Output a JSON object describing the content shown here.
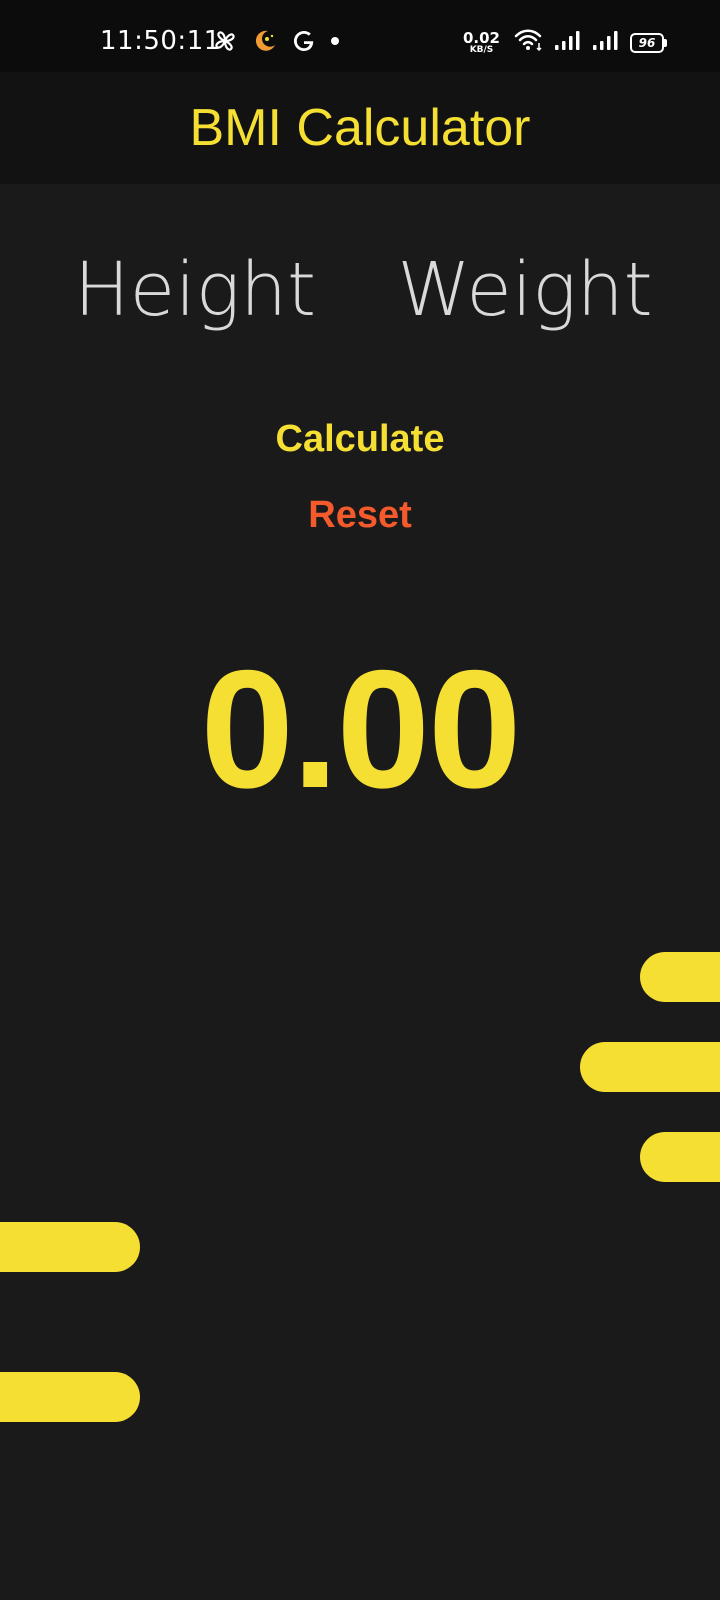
{
  "status_bar": {
    "time": "11:50:11",
    "net_speed_value": "0.02",
    "net_speed_unit": "KB/S",
    "battery_level": "96",
    "left_icons": [
      "pinwheel-icon",
      "moon-star-icon",
      "google-icon",
      "dot-icon"
    ],
    "right_icons": [
      "wifi-icon",
      "signal-icon",
      "signal-icon"
    ]
  },
  "app_bar": {
    "title": "BMI Calculator"
  },
  "inputs": {
    "height_placeholder": "Height",
    "weight_placeholder": "Weight"
  },
  "actions": {
    "calculate_label": "Calculate",
    "reset_label": "Reset"
  },
  "result": {
    "bmi_value": "0.00"
  },
  "colors": {
    "accent": "#f5df33",
    "reset": "#f55a2c",
    "background": "#1a1a1a",
    "app_bar": "#121212",
    "status_bar": "#0c0c0c",
    "placeholder_text": "#d9d9d9"
  }
}
